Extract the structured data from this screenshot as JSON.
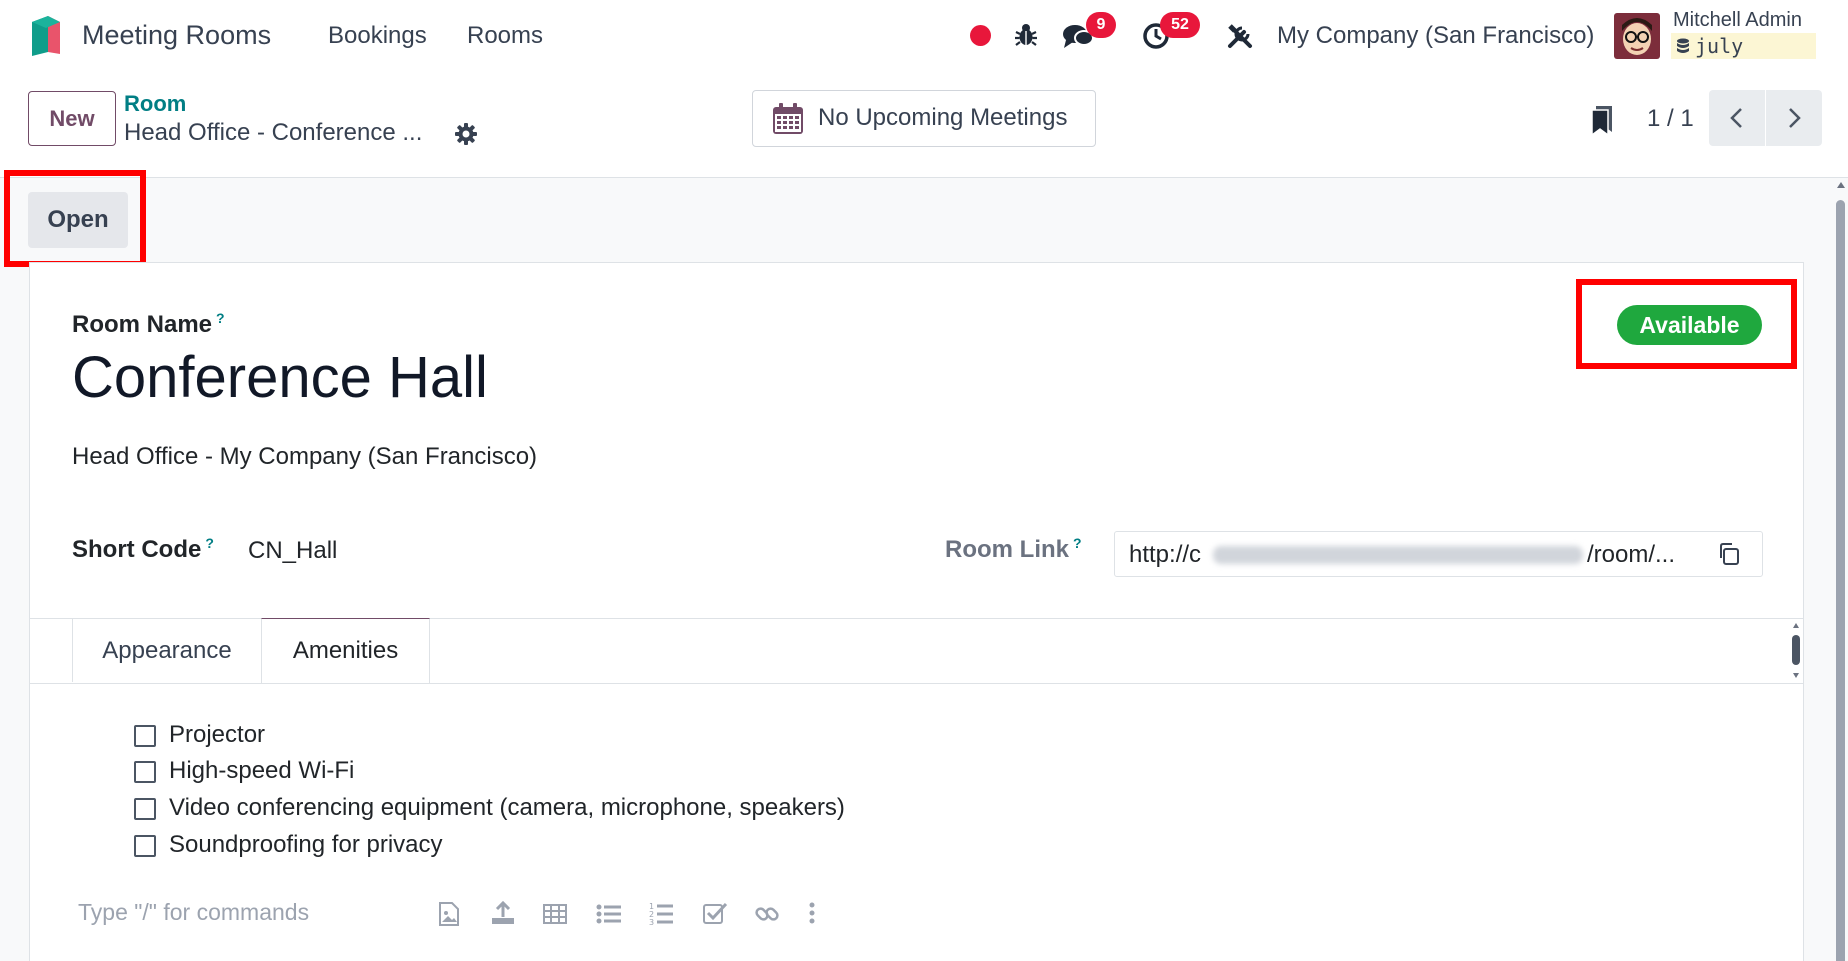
{
  "navbar": {
    "app_title": "Meeting Rooms",
    "menu": [
      "Bookings",
      "Rooms"
    ],
    "messages_badge": "9",
    "activities_badge": "52",
    "company": "My Company (San Francisco)",
    "user_name": "Mitchell Admin",
    "database": "july"
  },
  "control_panel": {
    "new_button": "New",
    "breadcrumb_parent": "Room",
    "breadcrumb_current": "Head Office - Conference ...",
    "upcoming_meetings": "No Upcoming Meetings",
    "pager": "1 / 1"
  },
  "statusbar": {
    "open_button": "Open"
  },
  "form": {
    "room_name_label": "Room Name",
    "help_mark": "?",
    "room_name": "Conference Hall",
    "office": "Head Office - My Company (San Francisco)",
    "short_code_label": "Short Code",
    "short_code": "CN_Hall",
    "room_link_label": "Room Link",
    "room_link_prefix": "http://c",
    "room_link_suffix": "/room/...",
    "status_badge": "Available",
    "status_color": "#1fa83e"
  },
  "tabs": [
    "Appearance",
    "Amenities"
  ],
  "amenities": [
    "Projector",
    "High-speed Wi-Fi",
    "Video conferencing equipment (camera, microphone, speakers)",
    "Soundproofing for privacy"
  ],
  "editor": {
    "placeholder": "Type \"/\" for commands"
  },
  "colors": {
    "brand": "#714b67",
    "accent": "#017e84",
    "highlight": "#ff0000"
  }
}
